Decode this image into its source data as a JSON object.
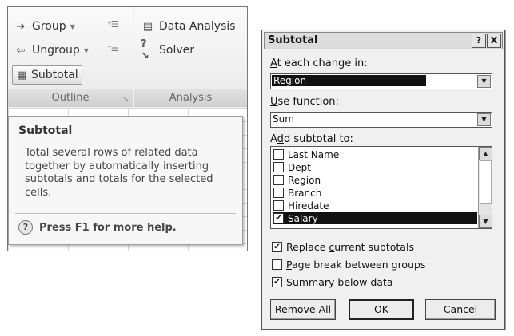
{
  "ribbon": {
    "group_label": "Group",
    "ungroup_label": "Ungroup",
    "subtotal_label": "Subtotal",
    "outline_label": "Outline",
    "data_analysis_label": "Data Analysis",
    "solver_label": "Solver",
    "analysis_label": "Analysis"
  },
  "tooltip": {
    "title": "Subtotal",
    "body": "Total several rows of related data together by automatically inserting subtotals and totals for the selected cells.",
    "help": "Press F1 for more help."
  },
  "dialog": {
    "title": "Subtotal",
    "help_btn": "?",
    "close_btn": "X",
    "at_each_change_label": "At each change in:",
    "at_each_change_value": "Region",
    "use_function_label": "Use function:",
    "use_function_value": "Sum",
    "add_subtotal_label": "Add subtotal to:",
    "fields": [
      {
        "label": "Last Name",
        "checked": false,
        "selected": false
      },
      {
        "label": "Dept",
        "checked": false,
        "selected": false
      },
      {
        "label": "Region",
        "checked": false,
        "selected": false
      },
      {
        "label": "Branch",
        "checked": false,
        "selected": false
      },
      {
        "label": "Hiredate",
        "checked": false,
        "selected": false
      },
      {
        "label": "Salary",
        "checked": true,
        "selected": true
      }
    ],
    "options": {
      "replace_label": "Replace current subtotals",
      "replace_checked": true,
      "page_break_label": "Page break between groups",
      "page_break_checked": false,
      "summary_label": "Summary below data",
      "summary_checked": true
    },
    "buttons": {
      "remove_all": "Remove All",
      "ok": "OK",
      "cancel": "Cancel"
    }
  }
}
